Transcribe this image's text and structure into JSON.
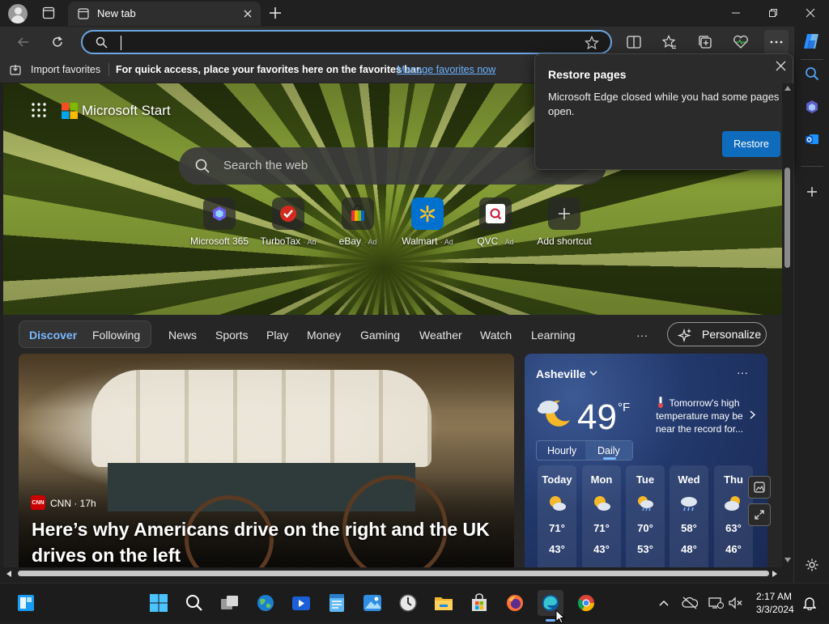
{
  "browser": {
    "tab_title": "New tab",
    "address_value": "",
    "favorites_bar": {
      "import_label": "Import favorites",
      "hint": "For quick access, place your favorites here on the favorites bar.",
      "manage_link": "Manage favorites now"
    }
  },
  "popup": {
    "title": "Restore pages",
    "message": "Microsoft Edge closed while you had some pages open.",
    "button": "Restore"
  },
  "start": {
    "brand": "Microsoft Start",
    "search_placeholder": "Search the web",
    "shortcuts": [
      {
        "label": "Microsoft 365",
        "ad": ""
      },
      {
        "label": "TurboTax",
        "ad": "· Ad"
      },
      {
        "label": "eBay",
        "ad": "· Ad"
      },
      {
        "label": "Walmart",
        "ad": "· Ad"
      },
      {
        "label": "QVC",
        "ad": "· Ad"
      },
      {
        "label": "Add shortcut",
        "ad": ""
      }
    ],
    "feed_tabs": [
      "Discover",
      "Following"
    ],
    "categories": [
      "News",
      "Sports",
      "Play",
      "Money",
      "Gaming",
      "Weather",
      "Watch",
      "Learning"
    ],
    "more": "···",
    "personalize": "Personalize"
  },
  "article": {
    "source": "CNN · 17h",
    "source_logo": "CNN",
    "headline": "Here’s why Americans drive on the right and the UK drives on the left"
  },
  "weather": {
    "location": "Asheville",
    "temp": "49",
    "unit": "°F",
    "tip": "Tomorrow's high temperature may be near the record for...",
    "toggle": [
      "Hourly",
      "Daily"
    ],
    "more": "···",
    "days": [
      {
        "name": "Today",
        "hi": "71°",
        "lo": "43°",
        "icon": "partly-sunny-icon"
      },
      {
        "name": "Mon",
        "hi": "71°",
        "lo": "43°",
        "icon": "partly-sunny-icon"
      },
      {
        "name": "Tue",
        "hi": "70°",
        "lo": "53°",
        "icon": "sun-rain-icon"
      },
      {
        "name": "Wed",
        "hi": "58°",
        "lo": "48°",
        "icon": "rain-icon"
      },
      {
        "name": "Thu",
        "hi": "63°",
        "lo": "46°",
        "icon": "partly-cloudy-icon"
      }
    ]
  },
  "taskbar": {
    "time": "2:17 AM",
    "date": "3/3/2024"
  },
  "colors": {
    "accent": "#0f6cbd",
    "link": "#6cb4ff",
    "address_border": "#6aa6e2"
  }
}
